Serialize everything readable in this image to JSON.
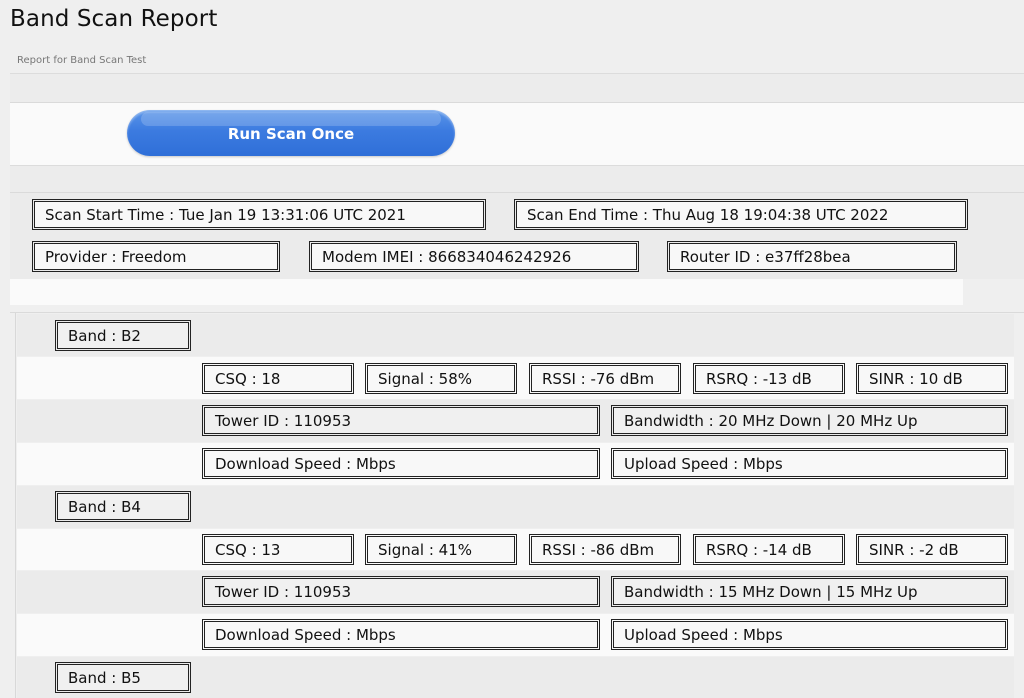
{
  "header": {
    "title": "Band Scan Report",
    "subtitle": "Report for Band Scan Test"
  },
  "actions": {
    "run_scan_label": "Run Scan Once"
  },
  "summary": {
    "scan_start": "Scan Start Time  :  Tue Jan 19 13:31:06 UTC 2021",
    "scan_end": "Scan End Time  :  Thu Aug 18 19:04:38 UTC 2022",
    "provider": "Provider  :  Freedom",
    "modem_imei": "Modem IMEI  :  866834046242926",
    "router_id": "Router ID  :  e37ff28bea"
  },
  "bands": [
    {
      "band": "Band : B2",
      "csq": "CSQ : 18",
      "signal": "Signal : 58%",
      "rssi": "RSSI : -76 dBm",
      "rsrq": "RSRQ : -13 dB",
      "sinr": "SINR : 10 dB",
      "tower_id": "Tower ID : 110953",
      "bandwidth": "Bandwidth : 20 MHz Down | 20 MHz Up",
      "download": "Download Speed : Mbps",
      "upload": "Upload Speed : Mbps"
    },
    {
      "band": "Band : B4",
      "csq": "CSQ : 13",
      "signal": "Signal : 41%",
      "rssi": "RSSI : -86 dBm",
      "rsrq": "RSRQ : -14 dB",
      "sinr": "SINR : -2 dB",
      "tower_id": "Tower ID : 110953",
      "bandwidth": "Bandwidth : 15 MHz Down | 15 MHz Up",
      "download": "Download Speed : Mbps",
      "upload": "Upload Speed : Mbps"
    },
    {
      "band": "Band : B5"
    }
  ],
  "colors": {
    "button_blue": "#3c7be0",
    "page_bg": "#efefef",
    "panel_bg": "#fafafa"
  }
}
